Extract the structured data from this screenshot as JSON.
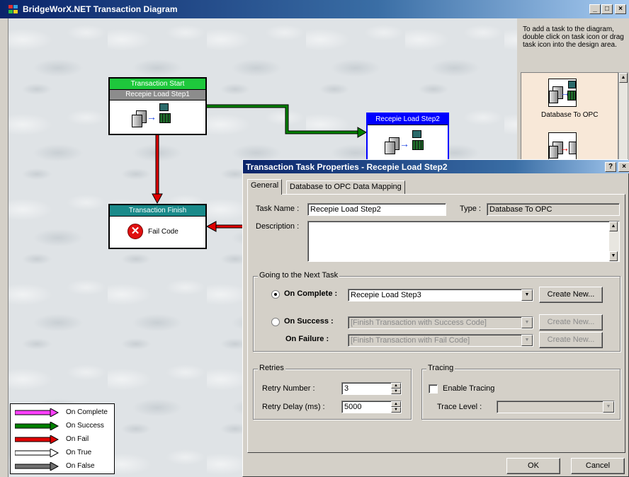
{
  "window": {
    "title": "BridgeWorX.NET Transaction Diagram",
    "minimize": "_",
    "maximize": "□",
    "close": "×"
  },
  "diagram": {
    "start_node": {
      "header": "Transaction Start",
      "subheader": "Recepie Load Step1",
      "header_color": "#1ec83c"
    },
    "step2_node": {
      "header": "Recepie Load Step2",
      "header_color": "#0000ff"
    },
    "finish_node": {
      "header": "Transaction Finish",
      "label": "Fail Code",
      "header_color": "#1a8a8a"
    },
    "connector_colors": {
      "success": "#008000",
      "fail": "#e00000"
    }
  },
  "legend": {
    "items": [
      {
        "label": "On Complete",
        "color": "#ff40ff"
      },
      {
        "label": "On Success",
        "color": "#008000"
      },
      {
        "label": "On Fail",
        "color": "#e00000"
      },
      {
        "label": "On True",
        "color": "#ffffff"
      },
      {
        "label": "On False",
        "color": "#707070"
      }
    ]
  },
  "toolbox": {
    "hint": "To add a task to the diagram, double click on task icon or drag task icon into the design area.",
    "items": [
      {
        "label": "Database To OPC"
      }
    ]
  },
  "dialog": {
    "title": "Transaction Task Properties - Recepie Load Step2",
    "help": "?",
    "close": "×",
    "tabs": [
      {
        "label": "General",
        "selected": true
      },
      {
        "label": "Database to OPC Data Mapping",
        "selected": false
      }
    ],
    "task_name_label": "Task Name :",
    "task_name_value": "Recepie Load Step2",
    "type_label": "Type :",
    "type_value": "Database To OPC",
    "description_label": "Description :",
    "description_value": "",
    "next_task": {
      "group_title": "Going to the Next Task",
      "on_complete_label": "On Complete :",
      "on_complete_value": "Recepie Load Step3",
      "on_complete_selected": true,
      "create_new": "Create New...",
      "on_success_label": "On Success :",
      "on_success_value": "[Finish Transaction with Success Code]",
      "on_failure_label": "On Failure :",
      "on_failure_value": "[Finish Transaction with Fail Code]"
    },
    "retries": {
      "group_title": "Retries",
      "retry_number_label": "Retry Number :",
      "retry_number_value": "3",
      "retry_delay_label": "Retry Delay (ms) :",
      "retry_delay_value": "5000"
    },
    "tracing": {
      "group_title": "Tracing",
      "enable_label": "Enable Tracing",
      "enabled": false,
      "trace_level_label": "Trace Level :",
      "trace_level_value": ""
    },
    "ok": "OK",
    "cancel": "Cancel"
  }
}
